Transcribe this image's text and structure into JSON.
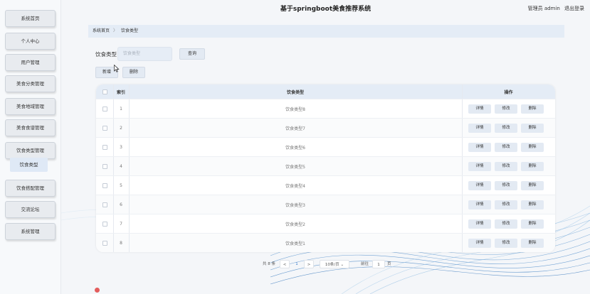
{
  "app": {
    "title": "基于springboot美食推荐系统",
    "user_label": "管理员 admin",
    "logout_label": "退出登录"
  },
  "sidebar": {
    "items": [
      {
        "label": "系统首页"
      },
      {
        "label": "个人中心"
      },
      {
        "label": "用户管理"
      },
      {
        "label": "美食分类管理"
      },
      {
        "label": "美食地域管理"
      },
      {
        "label": "美食食谱管理"
      },
      {
        "label": "饮食类型管理"
      },
      {
        "label": "饮食搭配管理"
      },
      {
        "label": "交流论坛"
      },
      {
        "label": "系统管理"
      }
    ],
    "active_sub": "饮食类型"
  },
  "breadcrumb": {
    "home": "系统首页",
    "separator": "〉",
    "current": "饮食类型"
  },
  "search": {
    "label": "饮食类型",
    "placeholder": "饮食类型",
    "query_button": "查询"
  },
  "actions": {
    "add_button": "新增",
    "delete_button": "删除"
  },
  "table": {
    "headers": {
      "index": "索引",
      "type": "饮食类型",
      "ops": "操作"
    },
    "op_labels": {
      "detail": "详情",
      "edit": "修改",
      "delete": "删除"
    },
    "rows": [
      {
        "index": "1",
        "type": "饮食类型8"
      },
      {
        "index": "2",
        "type": "饮食类型7"
      },
      {
        "index": "3",
        "type": "饮食类型6"
      },
      {
        "index": "4",
        "type": "饮食类型5"
      },
      {
        "index": "5",
        "type": "饮食类型4"
      },
      {
        "index": "6",
        "type": "饮食类型3"
      },
      {
        "index": "7",
        "type": "饮食类型2"
      },
      {
        "index": "8",
        "type": "饮食类型1"
      }
    ]
  },
  "pagination": {
    "total": "共 8 条",
    "prev": "<",
    "page": "1",
    "next": ">",
    "page_size": "10条/页",
    "goto_label": "前往",
    "goto_value": "1",
    "page_unit": "页"
  },
  "colors": {
    "accent": "#e4ecf6",
    "button_bg": "#e3eaf3",
    "wave": "#4a90c8"
  }
}
